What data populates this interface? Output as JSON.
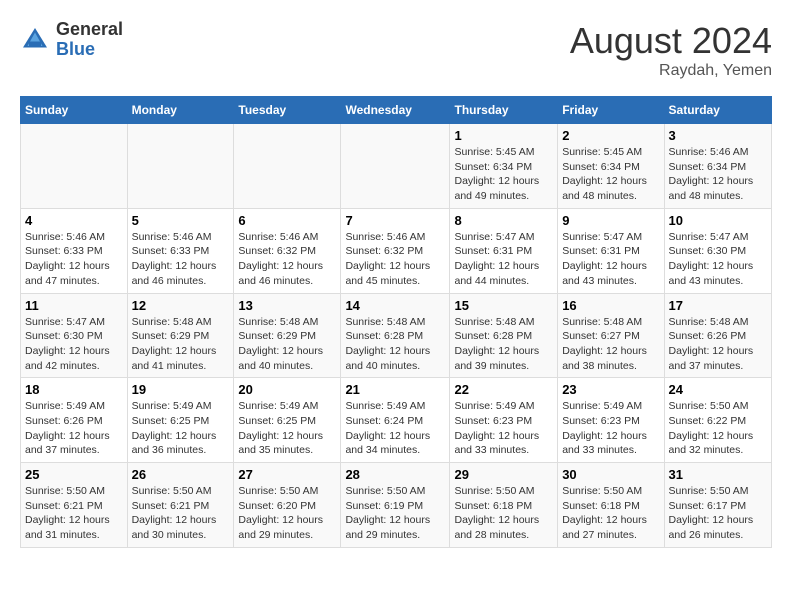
{
  "header": {
    "logo_general": "General",
    "logo_blue": "Blue",
    "month_year": "August 2024",
    "location": "Raydah, Yemen"
  },
  "days_of_week": [
    "Sunday",
    "Monday",
    "Tuesday",
    "Wednesday",
    "Thursday",
    "Friday",
    "Saturday"
  ],
  "weeks": [
    [
      {
        "day": "",
        "info": ""
      },
      {
        "day": "",
        "info": ""
      },
      {
        "day": "",
        "info": ""
      },
      {
        "day": "",
        "info": ""
      },
      {
        "day": "1",
        "info": "Sunrise: 5:45 AM\nSunset: 6:34 PM\nDaylight: 12 hours and 49 minutes."
      },
      {
        "day": "2",
        "info": "Sunrise: 5:45 AM\nSunset: 6:34 PM\nDaylight: 12 hours and 48 minutes."
      },
      {
        "day": "3",
        "info": "Sunrise: 5:46 AM\nSunset: 6:34 PM\nDaylight: 12 hours and 48 minutes."
      }
    ],
    [
      {
        "day": "4",
        "info": "Sunrise: 5:46 AM\nSunset: 6:33 PM\nDaylight: 12 hours and 47 minutes."
      },
      {
        "day": "5",
        "info": "Sunrise: 5:46 AM\nSunset: 6:33 PM\nDaylight: 12 hours and 46 minutes."
      },
      {
        "day": "6",
        "info": "Sunrise: 5:46 AM\nSunset: 6:32 PM\nDaylight: 12 hours and 46 minutes."
      },
      {
        "day": "7",
        "info": "Sunrise: 5:46 AM\nSunset: 6:32 PM\nDaylight: 12 hours and 45 minutes."
      },
      {
        "day": "8",
        "info": "Sunrise: 5:47 AM\nSunset: 6:31 PM\nDaylight: 12 hours and 44 minutes."
      },
      {
        "day": "9",
        "info": "Sunrise: 5:47 AM\nSunset: 6:31 PM\nDaylight: 12 hours and 43 minutes."
      },
      {
        "day": "10",
        "info": "Sunrise: 5:47 AM\nSunset: 6:30 PM\nDaylight: 12 hours and 43 minutes."
      }
    ],
    [
      {
        "day": "11",
        "info": "Sunrise: 5:47 AM\nSunset: 6:30 PM\nDaylight: 12 hours and 42 minutes."
      },
      {
        "day": "12",
        "info": "Sunrise: 5:48 AM\nSunset: 6:29 PM\nDaylight: 12 hours and 41 minutes."
      },
      {
        "day": "13",
        "info": "Sunrise: 5:48 AM\nSunset: 6:29 PM\nDaylight: 12 hours and 40 minutes."
      },
      {
        "day": "14",
        "info": "Sunrise: 5:48 AM\nSunset: 6:28 PM\nDaylight: 12 hours and 40 minutes."
      },
      {
        "day": "15",
        "info": "Sunrise: 5:48 AM\nSunset: 6:28 PM\nDaylight: 12 hours and 39 minutes."
      },
      {
        "day": "16",
        "info": "Sunrise: 5:48 AM\nSunset: 6:27 PM\nDaylight: 12 hours and 38 minutes."
      },
      {
        "day": "17",
        "info": "Sunrise: 5:48 AM\nSunset: 6:26 PM\nDaylight: 12 hours and 37 minutes."
      }
    ],
    [
      {
        "day": "18",
        "info": "Sunrise: 5:49 AM\nSunset: 6:26 PM\nDaylight: 12 hours and 37 minutes."
      },
      {
        "day": "19",
        "info": "Sunrise: 5:49 AM\nSunset: 6:25 PM\nDaylight: 12 hours and 36 minutes."
      },
      {
        "day": "20",
        "info": "Sunrise: 5:49 AM\nSunset: 6:25 PM\nDaylight: 12 hours and 35 minutes."
      },
      {
        "day": "21",
        "info": "Sunrise: 5:49 AM\nSunset: 6:24 PM\nDaylight: 12 hours and 34 minutes."
      },
      {
        "day": "22",
        "info": "Sunrise: 5:49 AM\nSunset: 6:23 PM\nDaylight: 12 hours and 33 minutes."
      },
      {
        "day": "23",
        "info": "Sunrise: 5:49 AM\nSunset: 6:23 PM\nDaylight: 12 hours and 33 minutes."
      },
      {
        "day": "24",
        "info": "Sunrise: 5:50 AM\nSunset: 6:22 PM\nDaylight: 12 hours and 32 minutes."
      }
    ],
    [
      {
        "day": "25",
        "info": "Sunrise: 5:50 AM\nSunset: 6:21 PM\nDaylight: 12 hours and 31 minutes."
      },
      {
        "day": "26",
        "info": "Sunrise: 5:50 AM\nSunset: 6:21 PM\nDaylight: 12 hours and 30 minutes."
      },
      {
        "day": "27",
        "info": "Sunrise: 5:50 AM\nSunset: 6:20 PM\nDaylight: 12 hours and 29 minutes."
      },
      {
        "day": "28",
        "info": "Sunrise: 5:50 AM\nSunset: 6:19 PM\nDaylight: 12 hours and 29 minutes."
      },
      {
        "day": "29",
        "info": "Sunrise: 5:50 AM\nSunset: 6:18 PM\nDaylight: 12 hours and 28 minutes."
      },
      {
        "day": "30",
        "info": "Sunrise: 5:50 AM\nSunset: 6:18 PM\nDaylight: 12 hours and 27 minutes."
      },
      {
        "day": "31",
        "info": "Sunrise: 5:50 AM\nSunset: 6:17 PM\nDaylight: 12 hours and 26 minutes."
      }
    ]
  ]
}
